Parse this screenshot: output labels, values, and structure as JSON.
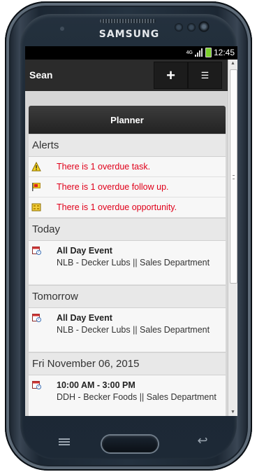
{
  "device": {
    "brand": "SAMSUNG"
  },
  "status_bar": {
    "network": "4G",
    "time": "12:45"
  },
  "app_bar": {
    "title": "Sean",
    "add_label": "+",
    "menu_label": "☰"
  },
  "panel": {
    "title": "Planner"
  },
  "alerts": {
    "header": "Alerts",
    "items": [
      {
        "icon": "warning-icon",
        "text": "There is 1 overdue task."
      },
      {
        "icon": "flag-icon",
        "text": "There is 1 overdue follow up."
      },
      {
        "icon": "opportunity-icon",
        "text": "There is 1 overdue opportunity."
      }
    ]
  },
  "sections": [
    {
      "header": "Today",
      "events": [
        {
          "icon": "calendar-event-icon",
          "title": "All Day Event",
          "subtitle": "NLB - Decker Lubs || Sales Department"
        }
      ]
    },
    {
      "header": "Tomorrow",
      "events": [
        {
          "icon": "calendar-event-icon",
          "title": "All Day Event",
          "subtitle": "NLB - Decker Lubs || Sales Department"
        }
      ]
    },
    {
      "header": "Fri November 06, 2015",
      "events": [
        {
          "icon": "calendar-event-icon",
          "title": "10:00 AM - 3:00 PM",
          "subtitle": "DDH - Becker Foods || Sales Department"
        }
      ]
    }
  ],
  "colors": {
    "alert_text": "#e0001a",
    "battery": "#7cd12b",
    "header_bg": "#2b2b2b"
  }
}
